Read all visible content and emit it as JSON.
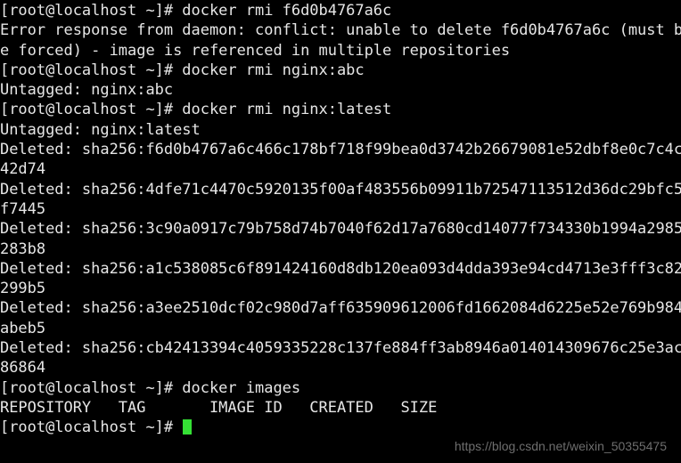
{
  "terminal": {
    "title": "root@localhost:~",
    "prompt": "[root@localhost ~]# ",
    "foreground_color": "#e6e6e6",
    "background_color": "#000000",
    "cursor_color": "#35e035",
    "lines": [
      "[root@localhost ~]# docker rmi f6d0b4767a6c",
      "Error response from daemon: conflict: unable to delete f6d0b4767a6c (must b",
      "e forced) - image is referenced in multiple repositories",
      "[root@localhost ~]# docker rmi nginx:abc",
      "Untagged: nginx:abc",
      "[root@localhost ~]# docker rmi nginx:latest",
      "Untagged: nginx:latest",
      "Deleted: sha256:f6d0b4767a6c466c178bf718f99bea0d3742b26679081e52dbf8e0c7c4c",
      "42d74",
      "Deleted: sha256:4dfe71c4470c5920135f00af483556b09911b72547113512d36dc29bfc5",
      "f7445",
      "Deleted: sha256:3c90a0917c79b758d74b7040f62d17a7680cd14077f734330b1994a2985",
      "283b8",
      "Deleted: sha256:a1c538085c6f891424160d8db120ea093d4dda393e94cd4713e3fff3c82",
      "299b5",
      "Deleted: sha256:a3ee2510dcf02c980d7aff635909612006fd1662084d6225e52e769b984",
      "abeb5",
      "Deleted: sha256:cb42413394c4059335228c137fe884ff3ab8946a014014309676c25e3ac",
      "86864",
      "[root@localhost ~]# docker images",
      "REPOSITORY   TAG       IMAGE ID   CREATED   SIZE"
    ],
    "final_prompt": "[root@localhost ~]# ",
    "images_table": {
      "headers": [
        "REPOSITORY",
        "TAG",
        "IMAGE ID",
        "CREATED",
        "SIZE"
      ],
      "rows": []
    },
    "commands": [
      "docker rmi f6d0b4767a6c",
      "docker rmi nginx:abc",
      "docker rmi nginx:latest",
      "docker images"
    ]
  },
  "watermark": {
    "text": "https://blog.csdn.net/weixin_50355475"
  }
}
